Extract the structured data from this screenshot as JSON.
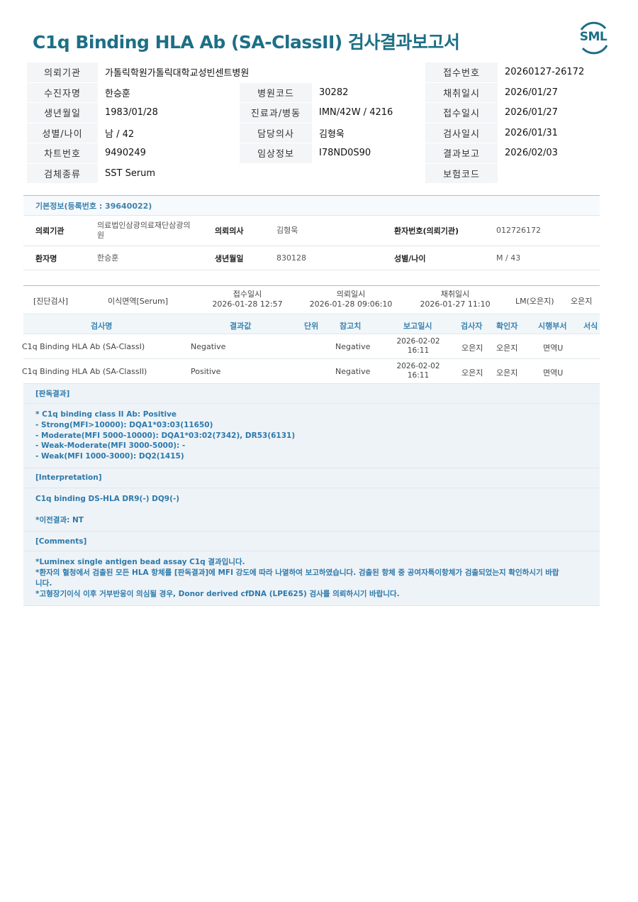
{
  "title": "C1q Binding HLA Ab (SA-ClassII) 검사결과보고서",
  "logo": "SML",
  "header": {
    "rows": [
      [
        {
          "l": "의뢰기관",
          "v": "가톨릭학원가톨릭대학교성빈센트병원",
          "span": true
        },
        {
          "l": "접수번호",
          "v": "20260127-26172"
        }
      ],
      [
        {
          "l": "수진자명",
          "v": "한승훈"
        },
        {
          "l": "병원코드",
          "v": "30282"
        },
        {
          "l": "채취일시",
          "v": "2026/01/27"
        }
      ],
      [
        {
          "l": "생년월일",
          "v": "1983/01/28"
        },
        {
          "l": "진료과/병동",
          "v": "IMN/42W / 4216"
        },
        {
          "l": "접수일시",
          "v": "2026/01/27"
        }
      ],
      [
        {
          "l": "성별/나이",
          "v": "남 / 42"
        },
        {
          "l": "담당의사",
          "v": "김형욱"
        },
        {
          "l": "검사일시",
          "v": "2026/01/31"
        }
      ],
      [
        {
          "l": "차트번호",
          "v": "9490249"
        },
        {
          "l": "임상정보",
          "v": "I78ND0S90"
        },
        {
          "l": "결과보고",
          "v": "2026/02/03"
        }
      ],
      [
        {
          "l": "검체종류",
          "v": "SST Serum",
          "span": true
        },
        {
          "l": "보험코드",
          "v": ""
        }
      ]
    ]
  },
  "basic": {
    "heading": "기본정보(등록번호 : 39640022)",
    "r1": {
      "l1": "의뢰기관",
      "v1a": "의료법인삼광의료재단삼광의",
      "v1b": "원",
      "l2": "의뢰의사",
      "v2": "김형욱",
      "l3": "환자번호(의뢰기관)",
      "v3": "012726172"
    },
    "r2": {
      "l1": "환자명",
      "v1": "한승훈",
      "l2": "생년월일",
      "v2": "830128",
      "l3": "성별/나이",
      "v3": "M / 43"
    }
  },
  "results": {
    "top": {
      "category": "[진단검사]",
      "dept": "이식면역[Serum]",
      "received_label": "접수일시",
      "received": "2026-01-28 12:57",
      "requested_label": "의뢰일시",
      "requested": "2026-01-28 09:06:10",
      "collected_label": "채취일시",
      "collected": "2026-01-27 11:10",
      "lm": "LM(오은지)",
      "person": "오은지"
    },
    "columns": {
      "test": "검사명",
      "result": "결과값",
      "unit": "단위",
      "ref": "참고치",
      "report": "보고일시",
      "tester": "검사자",
      "confirmer": "확인자",
      "dept": "시행부서",
      "form": "서식"
    },
    "rows": [
      {
        "test": "C1q Binding HLA Ab (SA-ClassI)",
        "result": "Negative",
        "ref": "Negative",
        "date": "2026-02-02",
        "time": "16:11",
        "tester": "오은지",
        "confirmer": "오은지",
        "dept": "면역U"
      },
      {
        "test": "C1q Binding HLA Ab (SA-ClassII)",
        "result": "Positive",
        "ref": "Negative",
        "date": "2026-02-02",
        "time": "16:11",
        "tester": "오은지",
        "confirmer": "오은지",
        "dept": "면역U"
      }
    ]
  },
  "notes": {
    "judgement_heading": "[판독결과]",
    "judgement_lines": [
      "* C1q binding class II Ab: Positive",
      "- Strong(MFI>10000): DQA1*03:03(11650)",
      "- Moderate(MFI 5000-10000): DQA1*03:02(7342), DR53(6131)",
      "- Weak-Moderate(MFI 3000-5000): -",
      "- Weak(MFI 1000-3000): DQ2(1415)"
    ],
    "interpretation_heading": "[Interpretation]",
    "interpretation_lines": [
      "C1q binding DS-HLA DR9(-) DQ9(-)",
      "",
      "*이전결과: NT"
    ],
    "comments_heading": "[Comments]",
    "comments_lines": [
      "*Luminex single antigen bead assay C1q 결과입니다.",
      "*환자의 혈청에서 검출된 모든 HLA 항체를 [판독결과]에 MFI 강도에 따라 나열하여 보고하였습니다. 검출된 항체 중 공여자특이항체가 검출되었는지 확인하시기 바랍",
      "니다.",
      "*고형장기이식 이후 거부반응이 의심될 경우, Donor derived cfDNA (LPE625) 검사를 의뢰하시기 바랍니다."
    ]
  }
}
